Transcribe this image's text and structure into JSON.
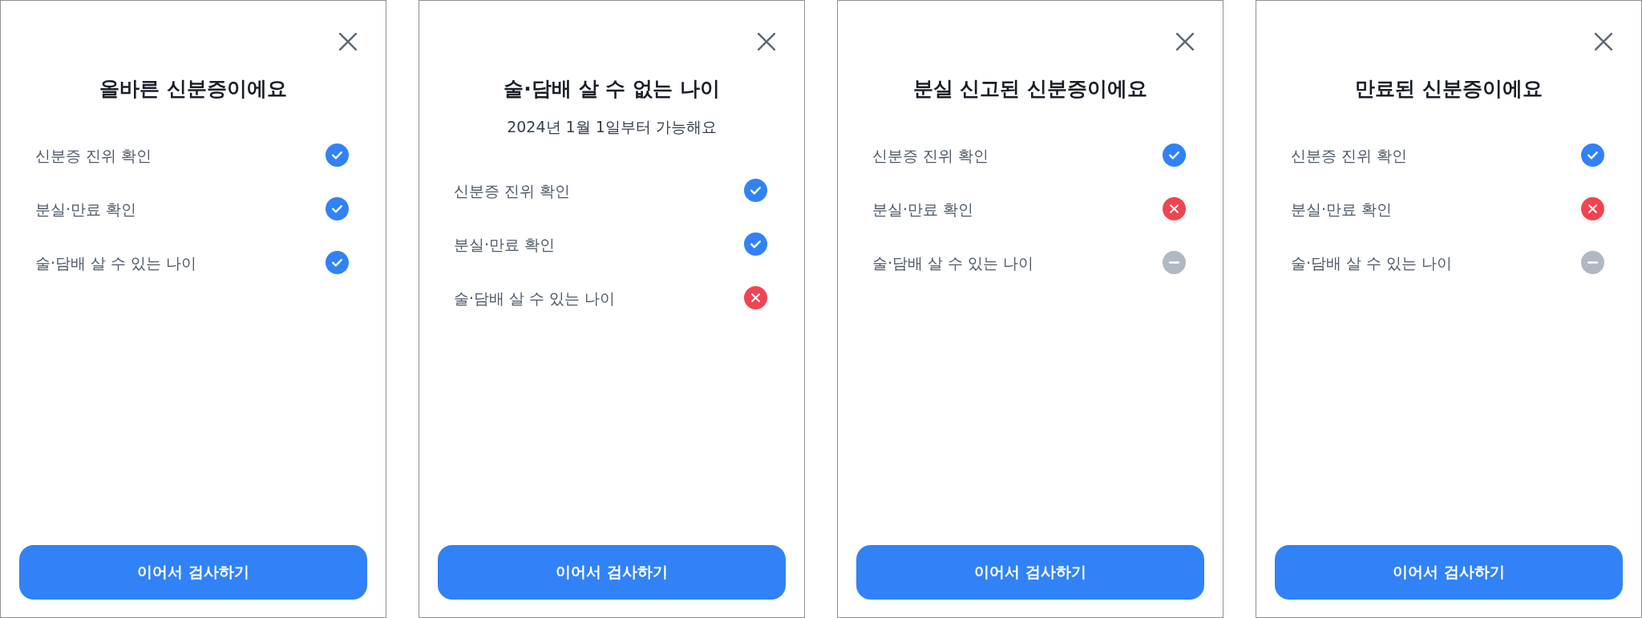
{
  "panels": [
    {
      "title": "올바른 신분증이에요",
      "checks": [
        {
          "label": "신분증 진위 확인",
          "kind": "passed"
        },
        {
          "label": "분실·만료 확인",
          "kind": "passed"
        },
        {
          "label": "술·담배 살 수 있는 나이",
          "kind": "passed"
        }
      ],
      "button": "이어서 검사하기"
    },
    {
      "title": "술·담배 살 수 없는 나이",
      "subtitle": "2024년 1월 1일부터 가능해요",
      "checks": [
        {
          "label": "신분증 진위 확인",
          "kind": "passed"
        },
        {
          "label": "분실·만료 확인",
          "kind": "passed"
        },
        {
          "label": "술·담배 살 수 있는 나이",
          "kind": "failed"
        }
      ],
      "button": "이어서 검사하기"
    },
    {
      "title": "분실 신고된 신분증이에요",
      "checks": [
        {
          "label": "신분증 진위 확인",
          "kind": "passed"
        },
        {
          "label": "분실·만료 확인",
          "kind": "failed"
        },
        {
          "label": "술·담배 살 수 있는 나이",
          "kind": "skipped"
        }
      ],
      "button": "이어서 검사하기"
    },
    {
      "title": "만료된 신분증이에요",
      "checks": [
        {
          "label": "신분증 진위 확인",
          "kind": "passed"
        },
        {
          "label": "분실·만료 확인",
          "kind": "failed"
        },
        {
          "label": "술·담배 살 수 있는 나이",
          "kind": "skipped"
        }
      ],
      "button": "이어서 검사하기"
    }
  ]
}
